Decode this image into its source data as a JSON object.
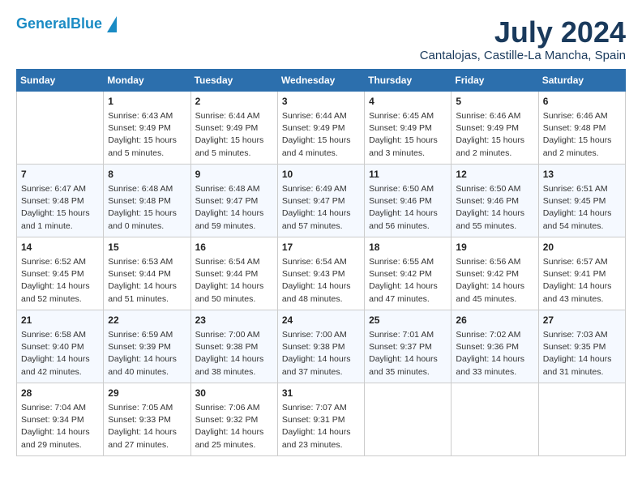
{
  "header": {
    "logo_line1": "General",
    "logo_line2": "Blue",
    "month": "July 2024",
    "location": "Cantalojas, Castille-La Mancha, Spain"
  },
  "weekdays": [
    "Sunday",
    "Monday",
    "Tuesday",
    "Wednesday",
    "Thursday",
    "Friday",
    "Saturday"
  ],
  "weeks": [
    [
      {
        "day": "",
        "info": ""
      },
      {
        "day": "1",
        "info": "Sunrise: 6:43 AM\nSunset: 9:49 PM\nDaylight: 15 hours\nand 5 minutes."
      },
      {
        "day": "2",
        "info": "Sunrise: 6:44 AM\nSunset: 9:49 PM\nDaylight: 15 hours\nand 5 minutes."
      },
      {
        "day": "3",
        "info": "Sunrise: 6:44 AM\nSunset: 9:49 PM\nDaylight: 15 hours\nand 4 minutes."
      },
      {
        "day": "4",
        "info": "Sunrise: 6:45 AM\nSunset: 9:49 PM\nDaylight: 15 hours\nand 3 minutes."
      },
      {
        "day": "5",
        "info": "Sunrise: 6:46 AM\nSunset: 9:49 PM\nDaylight: 15 hours\nand 2 minutes."
      },
      {
        "day": "6",
        "info": "Sunrise: 6:46 AM\nSunset: 9:48 PM\nDaylight: 15 hours\nand 2 minutes."
      }
    ],
    [
      {
        "day": "7",
        "info": "Sunrise: 6:47 AM\nSunset: 9:48 PM\nDaylight: 15 hours\nand 1 minute."
      },
      {
        "day": "8",
        "info": "Sunrise: 6:48 AM\nSunset: 9:48 PM\nDaylight: 15 hours\nand 0 minutes."
      },
      {
        "day": "9",
        "info": "Sunrise: 6:48 AM\nSunset: 9:47 PM\nDaylight: 14 hours\nand 59 minutes."
      },
      {
        "day": "10",
        "info": "Sunrise: 6:49 AM\nSunset: 9:47 PM\nDaylight: 14 hours\nand 57 minutes."
      },
      {
        "day": "11",
        "info": "Sunrise: 6:50 AM\nSunset: 9:46 PM\nDaylight: 14 hours\nand 56 minutes."
      },
      {
        "day": "12",
        "info": "Sunrise: 6:50 AM\nSunset: 9:46 PM\nDaylight: 14 hours\nand 55 minutes."
      },
      {
        "day": "13",
        "info": "Sunrise: 6:51 AM\nSunset: 9:45 PM\nDaylight: 14 hours\nand 54 minutes."
      }
    ],
    [
      {
        "day": "14",
        "info": "Sunrise: 6:52 AM\nSunset: 9:45 PM\nDaylight: 14 hours\nand 52 minutes."
      },
      {
        "day": "15",
        "info": "Sunrise: 6:53 AM\nSunset: 9:44 PM\nDaylight: 14 hours\nand 51 minutes."
      },
      {
        "day": "16",
        "info": "Sunrise: 6:54 AM\nSunset: 9:44 PM\nDaylight: 14 hours\nand 50 minutes."
      },
      {
        "day": "17",
        "info": "Sunrise: 6:54 AM\nSunset: 9:43 PM\nDaylight: 14 hours\nand 48 minutes."
      },
      {
        "day": "18",
        "info": "Sunrise: 6:55 AM\nSunset: 9:42 PM\nDaylight: 14 hours\nand 47 minutes."
      },
      {
        "day": "19",
        "info": "Sunrise: 6:56 AM\nSunset: 9:42 PM\nDaylight: 14 hours\nand 45 minutes."
      },
      {
        "day": "20",
        "info": "Sunrise: 6:57 AM\nSunset: 9:41 PM\nDaylight: 14 hours\nand 43 minutes."
      }
    ],
    [
      {
        "day": "21",
        "info": "Sunrise: 6:58 AM\nSunset: 9:40 PM\nDaylight: 14 hours\nand 42 minutes."
      },
      {
        "day": "22",
        "info": "Sunrise: 6:59 AM\nSunset: 9:39 PM\nDaylight: 14 hours\nand 40 minutes."
      },
      {
        "day": "23",
        "info": "Sunrise: 7:00 AM\nSunset: 9:38 PM\nDaylight: 14 hours\nand 38 minutes."
      },
      {
        "day": "24",
        "info": "Sunrise: 7:00 AM\nSunset: 9:38 PM\nDaylight: 14 hours\nand 37 minutes."
      },
      {
        "day": "25",
        "info": "Sunrise: 7:01 AM\nSunset: 9:37 PM\nDaylight: 14 hours\nand 35 minutes."
      },
      {
        "day": "26",
        "info": "Sunrise: 7:02 AM\nSunset: 9:36 PM\nDaylight: 14 hours\nand 33 minutes."
      },
      {
        "day": "27",
        "info": "Sunrise: 7:03 AM\nSunset: 9:35 PM\nDaylight: 14 hours\nand 31 minutes."
      }
    ],
    [
      {
        "day": "28",
        "info": "Sunrise: 7:04 AM\nSunset: 9:34 PM\nDaylight: 14 hours\nand 29 minutes."
      },
      {
        "day": "29",
        "info": "Sunrise: 7:05 AM\nSunset: 9:33 PM\nDaylight: 14 hours\nand 27 minutes."
      },
      {
        "day": "30",
        "info": "Sunrise: 7:06 AM\nSunset: 9:32 PM\nDaylight: 14 hours\nand 25 minutes."
      },
      {
        "day": "31",
        "info": "Sunrise: 7:07 AM\nSunset: 9:31 PM\nDaylight: 14 hours\nand 23 minutes."
      },
      {
        "day": "",
        "info": ""
      },
      {
        "day": "",
        "info": ""
      },
      {
        "day": "",
        "info": ""
      }
    ]
  ]
}
